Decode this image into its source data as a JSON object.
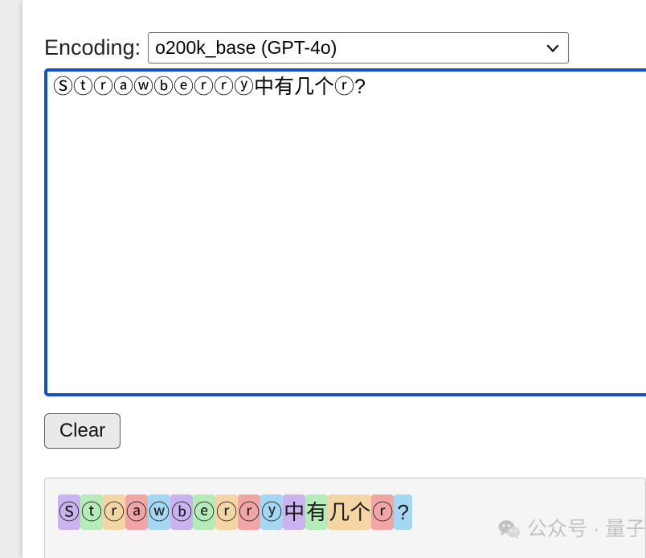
{
  "encoding": {
    "label": "Encoding:",
    "selected": "o200k_base (GPT-4o)",
    "chevron_icon": "chevron-down-icon"
  },
  "input": {
    "value": "Ⓢⓣⓡⓐⓦⓑⓔⓡⓡⓨ中有几个ⓡ?",
    "placeholder": ""
  },
  "actions": {
    "clear_label": "Clear"
  },
  "tokens": {
    "palette": [
      "#c9b4f0",
      "#b6ecb9",
      "#f4d6a5",
      "#f2a5a5",
      "#a5d6f2"
    ],
    "items": [
      {
        "text": "Ⓢ",
        "color": "#c9b4f0"
      },
      {
        "text": "ⓣ",
        "color": "#b6ecb9"
      },
      {
        "text": "ⓡ",
        "color": "#f4d6a5"
      },
      {
        "text": "ⓐ",
        "color": "#f2a5a5"
      },
      {
        "text": "ⓦ",
        "color": "#a5d6f2"
      },
      {
        "text": "ⓑ",
        "color": "#c9b4f0"
      },
      {
        "text": "ⓔ",
        "color": "#b6ecb9"
      },
      {
        "text": "ⓡ",
        "color": "#f4d6a5"
      },
      {
        "text": "ⓡ",
        "color": "#f2a5a5"
      },
      {
        "text": "ⓨ",
        "color": "#a5d6f2"
      },
      {
        "text": "中",
        "color": "#c9b4f0"
      },
      {
        "text": "有",
        "color": "#b6ecb9"
      },
      {
        "text": "几个",
        "color": "#f4d6a5"
      },
      {
        "text": "ⓡ",
        "color": "#f2a5a5"
      },
      {
        "text": "?",
        "color": "#a5d6f2"
      }
    ]
  },
  "watermark": {
    "icon": "wechat-icon",
    "text": "公众号 · 量子位"
  }
}
